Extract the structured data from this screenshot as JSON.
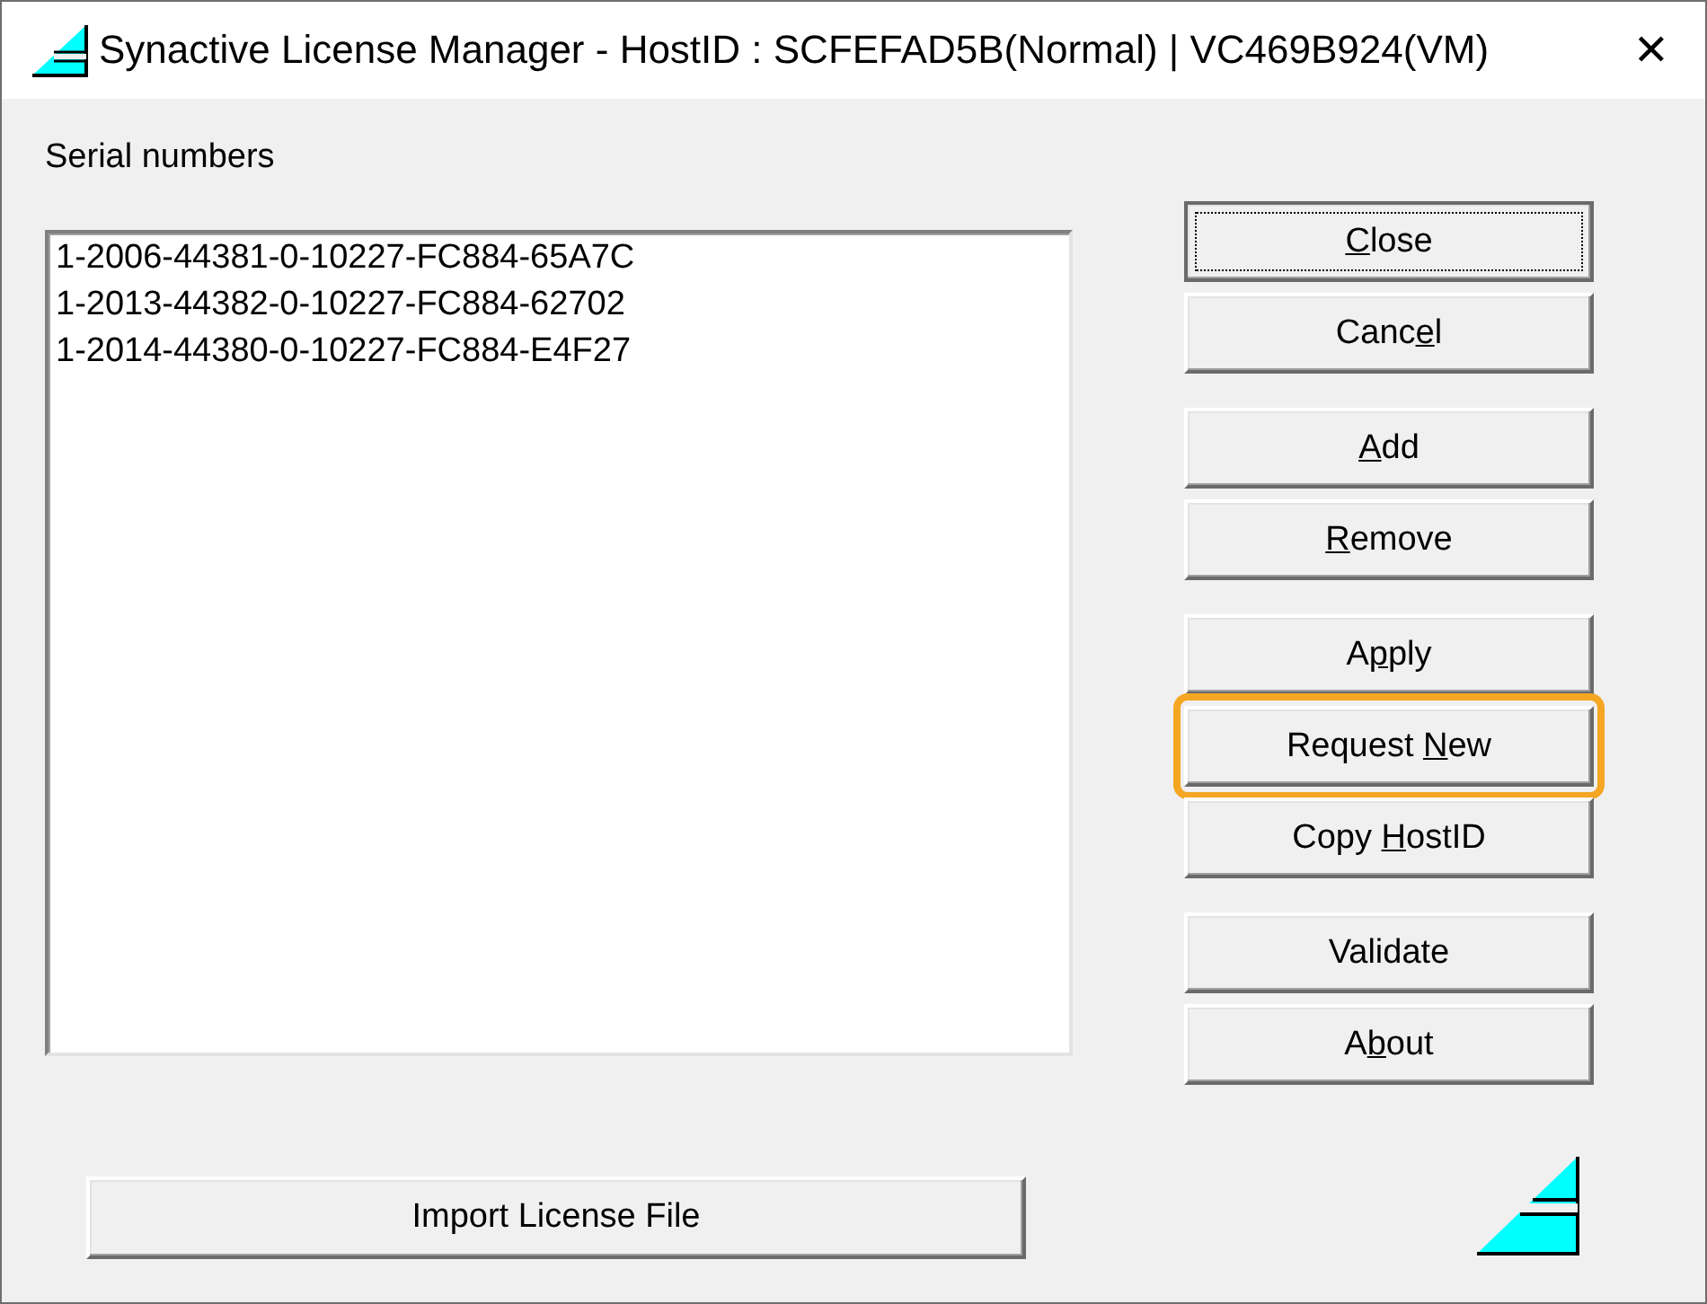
{
  "window": {
    "title": "Synactive License Manager - HostID : SCFEFAD5B(Normal) | VC469B924(VM)",
    "close": "✕"
  },
  "serial_numbers": {
    "label": "Serial numbers",
    "items": [
      {
        "text": "1-2006-44381-0-10227-FC884-65A7C"
      },
      {
        "text": "1-2013-44382-0-10227-FC884-62702"
      },
      {
        "text": "1-2014-44380-0-10227-FC884-E4F27"
      }
    ]
  },
  "buttons": [
    {
      "access_key": "C",
      "label_after": "lose",
      "focused": true,
      "highlighted": false,
      "group_start": false
    },
    {
      "label_before": "Canc",
      "access_key": "e",
      "label_after": "l",
      "focused": false,
      "highlighted": false,
      "group_start": false
    },
    {
      "access_key": "A",
      "label_after": "dd",
      "focused": false,
      "highlighted": false,
      "group_start": true
    },
    {
      "access_key": "R",
      "label_after": "emove",
      "focused": false,
      "highlighted": false,
      "group_start": false
    },
    {
      "label_before": "A",
      "access_key": "p",
      "label_after": "ply",
      "focused": false,
      "highlighted": false,
      "group_start": true
    },
    {
      "label_before": "Request ",
      "access_key": "N",
      "label_after": "ew",
      "focused": false,
      "highlighted": true,
      "group_start": false
    },
    {
      "label_before": "Copy ",
      "access_key": "H",
      "label_after": "ostID",
      "focused": false,
      "highlighted": false,
      "group_start": false
    },
    {
      "label_before": "Validate",
      "focused": false,
      "highlighted": false,
      "group_start": true
    },
    {
      "label_before": "A",
      "access_key": "b",
      "label_after": "out",
      "focused": false,
      "highlighted": false,
      "group_start": false
    }
  ],
  "import_button": {
    "label": "Import License File"
  }
}
